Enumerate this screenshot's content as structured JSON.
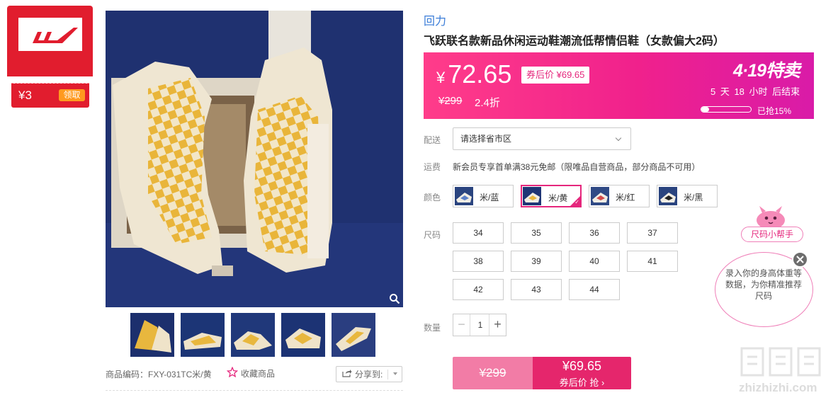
{
  "brand_badge": {
    "coupon_value": "¥3",
    "coupon_button": "领取"
  },
  "product": {
    "brand": "回力",
    "title": "飞跃联名款新品休闲运动鞋潮流低帮情侣鞋（女款偏大2码）",
    "sku_label": "商品编码：FXY-031TC米/黄",
    "favorite_label": "收藏商品",
    "share_label": "分享到:"
  },
  "price": {
    "currency": "¥",
    "current": "72.65",
    "coupon_price": "券后价 ¥69.65",
    "original": "¥299",
    "discount": "2.4折",
    "sale_title": "4·19特卖",
    "countdown": "5 天 18 小时 后结束",
    "sold_progress": 0.15,
    "sold_text": "已抢15%"
  },
  "labels": {
    "delivery": "配送",
    "shipping": "运费",
    "color": "颜色",
    "size": "尺码",
    "quantity": "数量"
  },
  "delivery": {
    "placeholder": "请选择省市区"
  },
  "shipping": {
    "text": "新会员专享首单满38元免邮（限唯品自营商品，部分商品不可用）"
  },
  "colors": [
    {
      "label": "米/蓝",
      "selected": false
    },
    {
      "label": "米/黄",
      "selected": true
    },
    {
      "label": "米/红",
      "selected": false
    },
    {
      "label": "米/黑",
      "selected": false
    }
  ],
  "sizes": [
    "34",
    "35",
    "36",
    "37",
    "38",
    "39",
    "40",
    "41",
    "42",
    "43",
    "44"
  ],
  "quantity": {
    "value": "1",
    "minus": "−",
    "plus": "+"
  },
  "buy_button": {
    "original": "¥299",
    "price": "¥69.65",
    "sub": "券后价 抢 ›"
  },
  "size_helper": {
    "title": "尺码小帮手",
    "text": "录入你的身高体重等数据，为你精准推荐尺码"
  },
  "watermark": {
    "text": "zhizhizhi.com"
  }
}
